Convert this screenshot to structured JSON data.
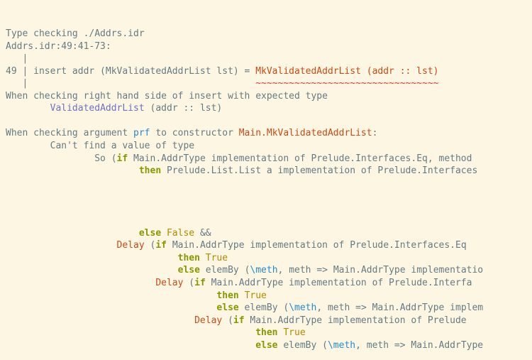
{
  "l1": "Type checking ./Addrs.idr",
  "l2": "Addrs.idr:49:41-73:",
  "l3": "   |",
  "l4a": "49 | insert addr (MkValidatedAddrList lst) = ",
  "l4b": "MkValidatedAddrList (addr :: lst)",
  "l5a": "   |                                         ",
  "l5b": "~~~~~~~~~~~~~~~~~~~~~~~~~~~~~~~~~",
  "l6": "When checking right hand side of insert with expected type",
  "l7a": "        ",
  "l7b": "ValidatedAddrList",
  "l7c": " (addr :: lst)",
  "l9a": "When checking argument ",
  "l9b": "prf",
  "l9c": " to constructor ",
  "l9d": "Main.MkValidatedAddrList",
  "l9e": ":",
  "l10": "        Can't find a value of type",
  "l11a": "                So (",
  "l11b": "if",
  "l11c": " Main.AddrType implementation of Prelude.Interfaces.Eq, method",
  "l12a": "                        ",
  "l12b": "then",
  "l12c": " Prelude.List.List a implementation of Prelude.Interfaces",
  "l17a": "                        ",
  "l17b": "else",
  "l17c": " ",
  "l17d": "False",
  "l17e": " &&",
  "l18a": "                    ",
  "l18b": "Delay",
  "l18c": " (",
  "l18d": "if",
  "l18e": " Main.AddrType implementation of Prelude.Interfaces.Eq",
  "l19a": "                               ",
  "l19b": "then",
  "l19c": " ",
  "l19d": "True",
  "l20a": "                               ",
  "l20b": "else",
  "l20c": " elemBy (",
  "l20d": "\\meth",
  "l20e": ", meth => Main.AddrType implementatio",
  "l21a": "                           ",
  "l21b": "Delay",
  "l21c": " (",
  "l21d": "if",
  "l21e": " Main.AddrType implementation of Prelude.Interfa",
  "l22a": "                                      ",
  "l22b": "then",
  "l22c": " ",
  "l22d": "True",
  "l23a": "                                      ",
  "l23b": "else",
  "l23c": " elemBy (",
  "l23d": "\\meth",
  "l23e": ", meth => Main.AddrType implem",
  "l24a": "                                  ",
  "l24b": "Delay",
  "l24c": " (",
  "l24d": "if",
  "l24e": " Main.AddrType implementation of Prelude",
  "l25a": "                                             ",
  "l25b": "then",
  "l25c": " ",
  "l25d": "True",
  "l26a": "                                             ",
  "l26b": "else",
  "l26c": " elemBy (",
  "l26d": "\\meth",
  "l26e": ", meth => Main.AddrType"
}
